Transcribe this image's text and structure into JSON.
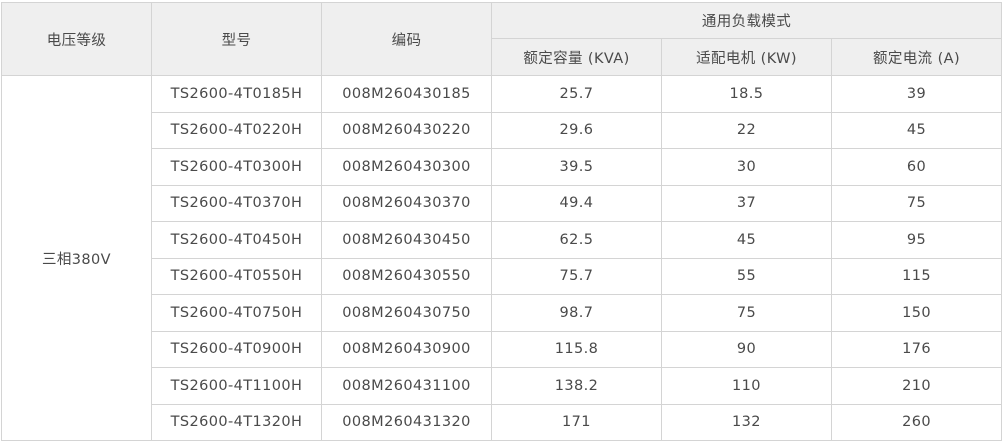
{
  "table": {
    "headers": {
      "voltage": "电压等级",
      "model": "型号",
      "code": "编码",
      "group": "通用负载模式",
      "capacity": "额定容量 (KVA)",
      "motor": "适配电机 (KW)",
      "current": "额定电流 (A)"
    },
    "voltage_value": "三相380V",
    "rows": [
      {
        "model": "TS2600-4T0185H",
        "code": "008M260430185",
        "capacity": "25.7",
        "motor": "18.5",
        "current": "39"
      },
      {
        "model": "TS2600-4T0220H",
        "code": "008M260430220",
        "capacity": "29.6",
        "motor": "22",
        "current": "45"
      },
      {
        "model": "TS2600-4T0300H",
        "code": "008M260430300",
        "capacity": "39.5",
        "motor": "30",
        "current": "60"
      },
      {
        "model": "TS2600-4T0370H",
        "code": "008M260430370",
        "capacity": "49.4",
        "motor": "37",
        "current": "75"
      },
      {
        "model": "TS2600-4T0450H",
        "code": "008M260430450",
        "capacity": "62.5",
        "motor": "45",
        "current": "95"
      },
      {
        "model": "TS2600-4T0550H",
        "code": "008M260430550",
        "capacity": "75.7",
        "motor": "55",
        "current": "115"
      },
      {
        "model": "TS2600-4T0750H",
        "code": "008M260430750",
        "capacity": "98.7",
        "motor": "75",
        "current": "150"
      },
      {
        "model": "TS2600-4T0900H",
        "code": "008M260430900",
        "capacity": "115.8",
        "motor": "90",
        "current": "176"
      },
      {
        "model": "TS2600-4T1100H",
        "code": "008M260431100",
        "capacity": "138.2",
        "motor": "110",
        "current": "210"
      },
      {
        "model": "TS2600-4T1320H",
        "code": "008M260431320",
        "capacity": "171",
        "motor": "132",
        "current": "260"
      }
    ]
  }
}
